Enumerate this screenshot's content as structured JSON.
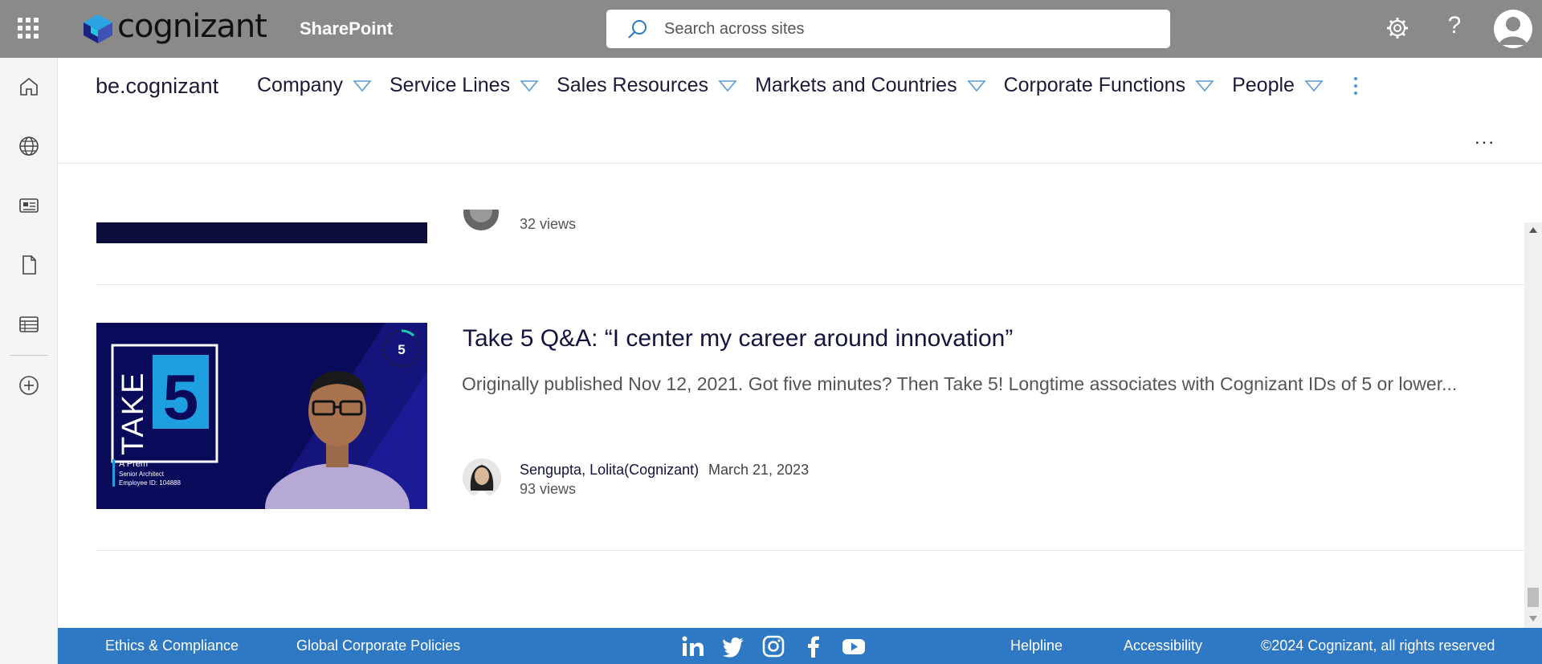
{
  "topbar": {
    "brand": "cognizant",
    "app_name": "SharePoint",
    "search_placeholder": "Search across sites",
    "help_symbol": "?"
  },
  "sitenav": {
    "site_title": "be.cognizant",
    "menu": [
      {
        "label": "Company"
      },
      {
        "label": "Service Lines"
      },
      {
        "label": "Sales Resources"
      },
      {
        "label": "Markets and Countries"
      },
      {
        "label": "Corporate Functions"
      },
      {
        "label": "People"
      }
    ],
    "more_label": "..."
  },
  "rail": {
    "icons": [
      "home-icon",
      "globe-icon",
      "news-icon",
      "document-icon",
      "list-icon",
      "add-icon"
    ]
  },
  "news": {
    "previous": {
      "views": "32 views"
    },
    "item": {
      "title": "Take 5 Q&A: “I center my career around innovation”",
      "description": "Originally published Nov 12, 2021. Got five minutes? Then Take 5! Longtime associates with Cognizant IDs of 5 or lower...",
      "author": "Sengupta, Lolita(Cognizant)",
      "date": "March 21, 2023",
      "views": "93 views",
      "thumbnail": {
        "take_label": "TAKE",
        "number": "5",
        "badge": "5",
        "person_name": "A Prem",
        "person_role": "Senior Architect",
        "person_id": "Employee ID: 104888"
      }
    }
  },
  "footer": {
    "ethics": "Ethics & Compliance",
    "policies": "Global Corporate Policies",
    "social": [
      "linkedin-icon",
      "twitter-icon",
      "instagram-icon",
      "facebook-icon",
      "youtube-icon"
    ],
    "helpline": "Helpline",
    "accessibility": "Accessibility",
    "copyright": "©2024 Cognizant, all rights reserved"
  },
  "colors": {
    "topbar": "#8a8a8a",
    "footer": "#2f78c4",
    "title": "#131340",
    "thumb_bg": "#0d0d5c",
    "thumb_accent": "#1e9fe0"
  }
}
